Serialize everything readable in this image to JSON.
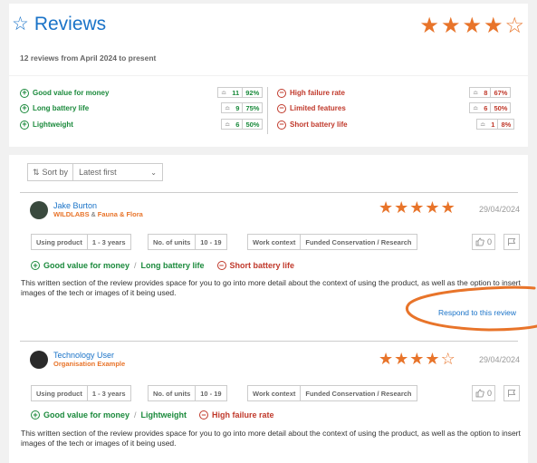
{
  "header": {
    "title": "Reviews",
    "period": "12 reviews from April 2024 to present",
    "rating_stars": 4,
    "rating_max": 5
  },
  "summary": {
    "pros": [
      {
        "label": "Good value for money",
        "count": "11",
        "percent": "92%"
      },
      {
        "label": "Long battery life",
        "count": "9",
        "percent": "75%"
      },
      {
        "label": "Lightweight",
        "count": "6",
        "percent": "50%"
      }
    ],
    "cons": [
      {
        "label": "High failure rate",
        "count": "8",
        "percent": "67%"
      },
      {
        "label": "Limited features",
        "count": "6",
        "percent": "50%"
      },
      {
        "label": "Short battery life",
        "count": "1",
        "percent": "8%"
      }
    ]
  },
  "sort": {
    "label": "Sort by",
    "value": "Latest first"
  },
  "reviews": [
    {
      "name": "Jake Burton",
      "org": "WILDLABS",
      "org_sep": "&",
      "org2": "Fauna & Flora",
      "stars": 5,
      "date": "29/04/2024",
      "context": {
        "using_label": "Using product",
        "using_value": "1 - 3 years",
        "units_label": "No. of units",
        "units_value": "10 - 19",
        "work_label": "Work context",
        "work_value": "Funded Conservation / Research"
      },
      "likes": "0",
      "pros": [
        "Good value for money",
        "Long battery life"
      ],
      "pros_sep": "/",
      "cons": [
        "Short battery life"
      ],
      "body": "This written section of the review provides space for you to go into more detail about the context of using the product, as well as the option to insert images of the tech or images of it being used.",
      "respond": "Respond to this review"
    },
    {
      "name": "Technology User",
      "org": "Organisation Example",
      "stars": 4,
      "date": "29/04/2024",
      "context": {
        "using_label": "Using product",
        "using_value": "1 - 3 years",
        "units_label": "No. of units",
        "units_value": "10 - 19",
        "work_label": "Work context",
        "work_value": "Funded Conservation / Research"
      },
      "likes": "0",
      "pros": [
        "Good value for money",
        "Lightweight"
      ],
      "pros_sep": "/",
      "cons": [
        "High failure rate"
      ],
      "body": "This written section of the review provides space for you to go into more detail about the context of using the product, as well as the option to insert images of the tech or images of it being used."
    }
  ],
  "icons": {
    "star_outline": "star-outline-icon",
    "star_filled": "star-filled-icon",
    "people": "people-icon",
    "plus": "plus-circle-icon",
    "minus": "minus-circle-icon",
    "sort": "sort-icon",
    "chevron": "chevron-down-icon",
    "thumbs_up": "thumbs-up-icon",
    "flag": "flag-icon"
  },
  "colors": {
    "accent_blue": "#1a73c8",
    "accent_orange": "#e8742a",
    "pro_green": "#1b8a3c",
    "con_red": "#c0392b"
  }
}
